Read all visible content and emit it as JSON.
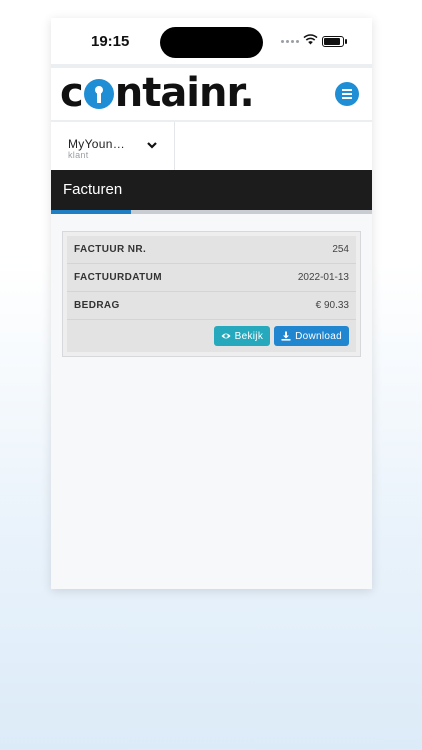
{
  "status_bar": {
    "time": "19:15"
  },
  "header": {
    "logo_text_a": "c",
    "logo_text_b": "ntainr."
  },
  "account": {
    "name": "MyYoun…",
    "role": "klant"
  },
  "page": {
    "title": "Facturen",
    "progress_fraction": 0.25
  },
  "invoice": {
    "rows": [
      {
        "label": "FACTUUR NR.",
        "value": "254"
      },
      {
        "label": "FACTUURDATUM",
        "value": "2022-01-13"
      },
      {
        "label": "BEDRAG",
        "value": "€ 90.33"
      }
    ],
    "view_label": "Bekijk",
    "download_label": "Download"
  },
  "colors": {
    "accent": "#1f8ed4",
    "titlebar": "#1c1c1c",
    "view_button": "#27a9bd",
    "download_button": "#1f86cf"
  },
  "icons": {
    "menu": "hamburger-icon",
    "account_toggle": "chevron-down-icon",
    "view": "eye-icon",
    "download": "download-icon"
  }
}
